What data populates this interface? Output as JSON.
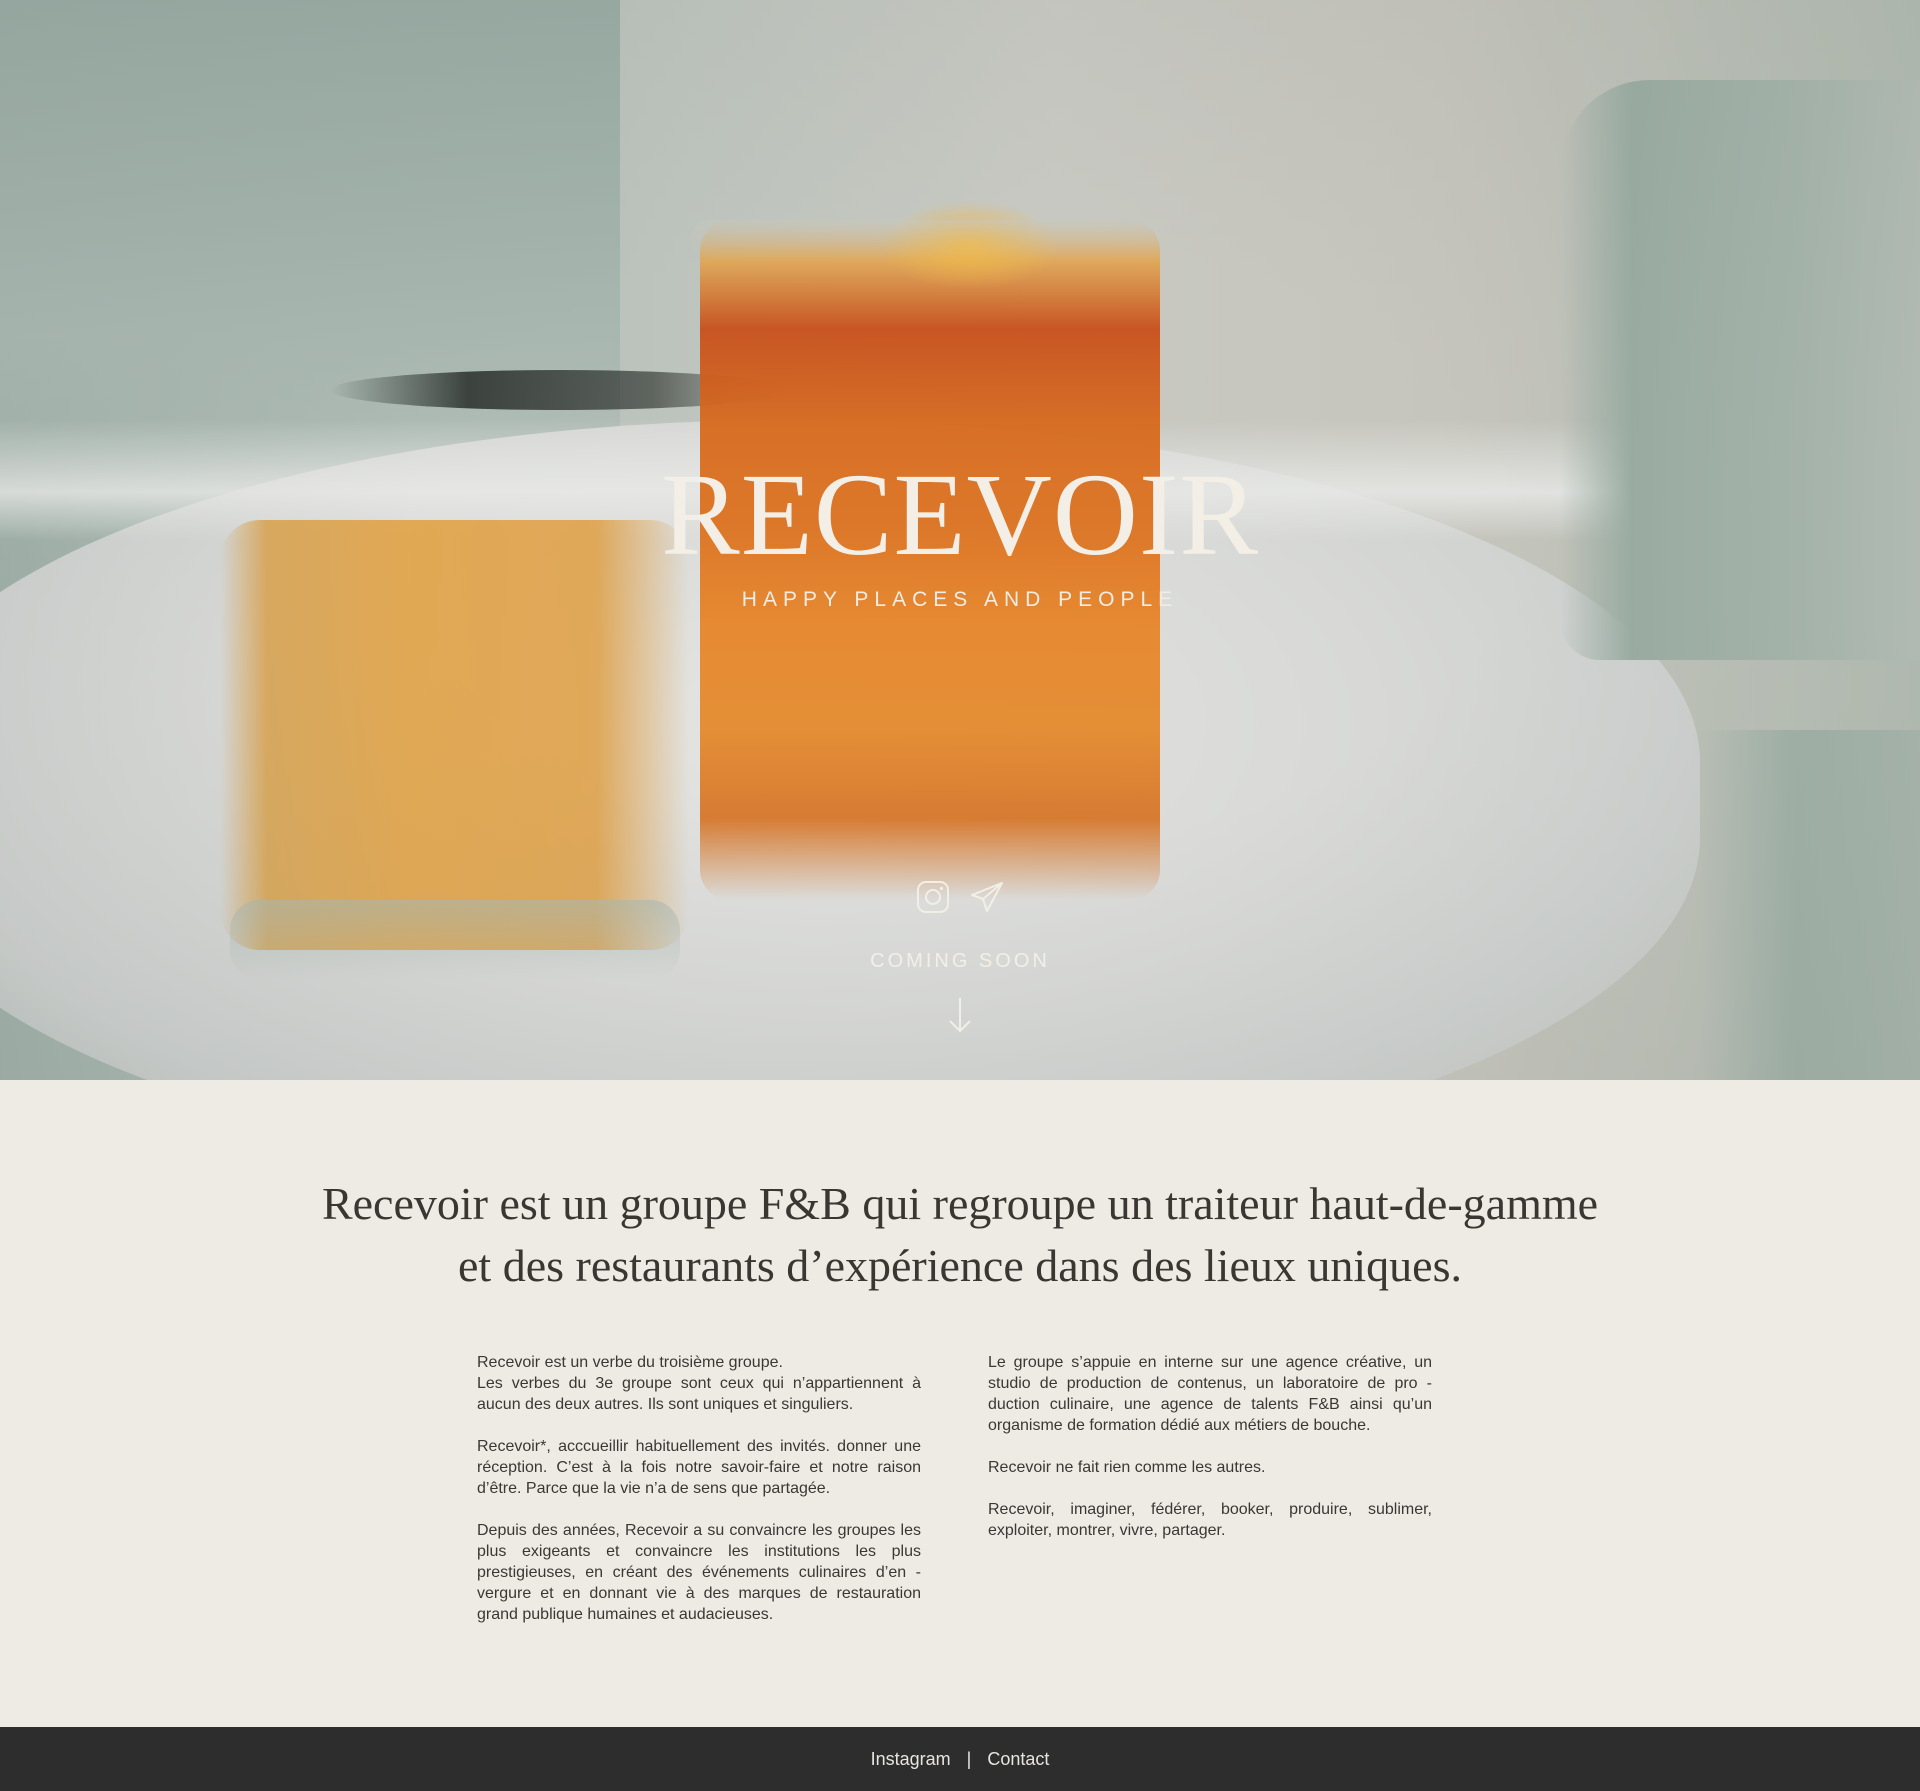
{
  "hero": {
    "brand": "RECEVOIR",
    "tagline": "HAPPY PLACES AND PEOPLE",
    "coming_soon": "COMING SOON",
    "social_icons": [
      "instagram-icon",
      "paper-plane-icon",
      "arrow-down-icon"
    ]
  },
  "about": {
    "headline_line1": "Recevoir est un groupe F&B qui regroupe un traiteur haut-de-gamme",
    "headline_line2": "et des restaurants d’expérience dans des lieux uniques.",
    "left_column": [
      "Recevoir est un verbe du troisième groupe.\nLes verbes du 3e groupe sont ceux qui n’appartiennent à aucun des deux autres.  Ils sont uniques et singuliers.",
      "Recevoir*, acccueillir habituellement des invités. donner une réception. C’est à la fois notre savoir-faire et notre raison d’être. Parce que la vie n’a de sens que partagée.",
      "Depuis des années, Recevoir a su convaincre les groupes les plus exigeants et convaincre les institutions les plus prestigieuses, en créant des événements culinaires d’en - vergure et en donnant vie à des marques de restauration grand publique humaines et audacieuses."
    ],
    "right_column": [
      "Le groupe s’appuie en interne sur une agence créative, un studio de production de contenus, un laboratoire de pro - duction culinaire, une agence de talents F&B ainsi qu’un organisme de formation dédié aux métiers de bouche.",
      "Recevoir ne fait rien comme les autres.",
      "Recevoir, imaginer, fédérer, booker, produire, sublimer, exploiter, montrer, vivre, partager."
    ]
  },
  "footer": {
    "instagram_label": "Instagram",
    "separator": "|",
    "contact_label": "Contact"
  },
  "colors": {
    "hero_text": "#f3efe6",
    "body_bg": "#eeebe5",
    "body_text": "#3b3733",
    "footer_bg": "#2d2d2d",
    "footer_text": "#e8e5df"
  }
}
